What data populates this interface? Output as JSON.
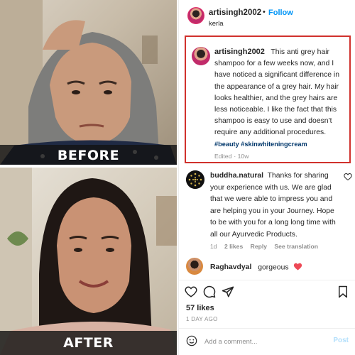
{
  "photos": {
    "before_label": "BEFORE",
    "after_label": "AFTER"
  },
  "header": {
    "username": "artisingh2002",
    "dot": "•",
    "follow_label": "Follow",
    "location": "kerla",
    "more_icon": "more-horizontal-icon"
  },
  "caption": {
    "username": "artisingh2002",
    "text": "This anti grey hair shampoo for a few weeks now, and I have noticed a significant difference in the appearance of a grey hair. My hair looks healthier, and the grey hairs are less noticeable. I like the fact that this shampoo is easy to use and doesn't require any additional procedures.",
    "hashtags": "#beauty #skinwhiteningcream",
    "edited": "Edited",
    "dot": "·",
    "time": "10w",
    "highlight_color": "#d0312d"
  },
  "reply": {
    "username": "buddha.natural",
    "text": "Thanks for sharing your experience with us. We are glad that we were able to impress you and are helping you in your Journey. Hope to be with you for a long long time with all our Ayurvedic Products.",
    "time": "1d",
    "likes": "2 likes",
    "reply_label": "Reply",
    "see_translation": "See translation",
    "heart_icon": "heart-outline-icon"
  },
  "comment2": {
    "username": "Raghavdyal",
    "text": "gorgeous",
    "heart_color": "#ed4956"
  },
  "actions": {
    "icons": [
      "heart-icon",
      "comment-icon",
      "share-icon",
      "bookmark-icon"
    ],
    "likes": "57 likes",
    "when": "1 DAY AGO"
  },
  "add_comment": {
    "placeholder": "Add a comment...",
    "post_label": "Post",
    "emoji_icon": "emoji-icon"
  }
}
